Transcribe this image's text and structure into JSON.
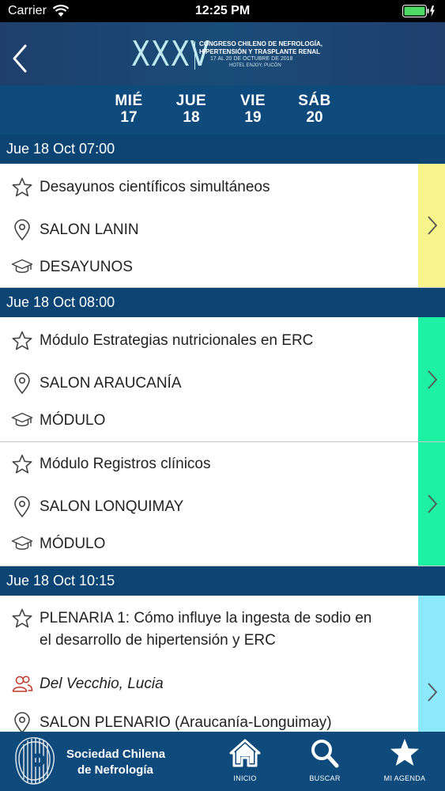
{
  "status_bar": {
    "carrier": "Carrier",
    "time": "12:25 PM"
  },
  "header": {
    "logo": {
      "roman": "XXXV",
      "line1": "CONGRESO CHILENO DE NEFROLOGÍA,",
      "line2": "HIPERTENSIÓN Y TRASPLANTE RENAL",
      "line3": "17 AL 20 DE OCTUBRE DE 2018",
      "line4": "HOTEL ENJOY, PUCÓN"
    }
  },
  "days": [
    {
      "name": "MIÉ",
      "num": "17"
    },
    {
      "name": "JUE",
      "num": "18"
    },
    {
      "name": "VIE",
      "num": "19"
    },
    {
      "name": "SÁB",
      "num": "20"
    }
  ],
  "sections": [
    {
      "heading": "Jue 18 Oct 07:00",
      "items": [
        {
          "title": "Desayunos científicos simultáneos",
          "location": "SALON LANIN",
          "type": "DESAYUNOS",
          "color": "#f7f48b"
        }
      ]
    },
    {
      "heading": "Jue 18 Oct 08:00",
      "items": [
        {
          "title": "Módulo Estrategias nutricionales en ERC",
          "location": "SALON ARAUCANÍA",
          "type": "MÓDULO",
          "color": "#1ef1a3"
        },
        {
          "title": "Módulo Registros clínicos",
          "location": "SALON LONQUIMAY",
          "type": "MÓDULO",
          "color": "#1ef1a3"
        }
      ]
    },
    {
      "heading": "Jue 18 Oct 10:15",
      "items": [
        {
          "title_line1": "PLENARIA 1: Cómo influye la ingesta de sodio en",
          "title_line2": "el desarrollo de hipertensión y ERC",
          "speaker": "Del Vecchio, Lucia",
          "location": "SALON PLENARIO (Araucanía-Longuimay)",
          "color": "#8ce9fb"
        }
      ]
    }
  ],
  "tabbar": {
    "brand_line1": "Sociedad Chilena",
    "brand_line2": "de Nefrología",
    "tabs": [
      {
        "label": "INICIO",
        "icon": "home-icon"
      },
      {
        "label": "BUSCAR",
        "icon": "search-icon"
      },
      {
        "label": "MI AGENDA",
        "icon": "star-icon"
      }
    ]
  },
  "colors": {
    "header": "#1a4c78",
    "section": "#0c4574",
    "tabbar": "#0e4a7c",
    "speaker_icon": "#c0392b"
  }
}
